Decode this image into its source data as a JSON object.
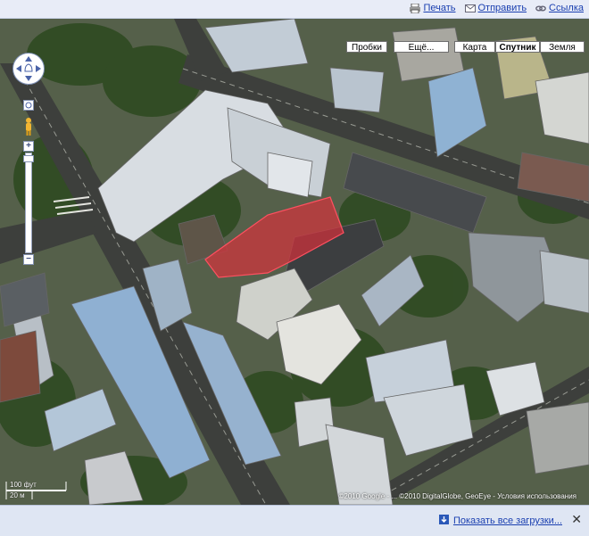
{
  "toolbar": {
    "print": "Печать",
    "send": "Отправить",
    "link": "Ссылка"
  },
  "map_controls": {
    "traffic": "Пробки",
    "more": "Ещё...",
    "map": "Карта",
    "satellite": "Спутник",
    "earth": "Земля",
    "active": "satellite"
  },
  "scale": {
    "feet": "100 фут",
    "meters": "20 м"
  },
  "copyright": "©2010 Google - ... ©2010 DigitalGlobe, GeoEye - Условия использования",
  "downloads": {
    "show_all": "Показать все загрузки...",
    "close": "✕"
  },
  "colors": {
    "highlight": "#e0303a",
    "link": "#1a3fb0",
    "topbar": "#e8ecf7"
  }
}
